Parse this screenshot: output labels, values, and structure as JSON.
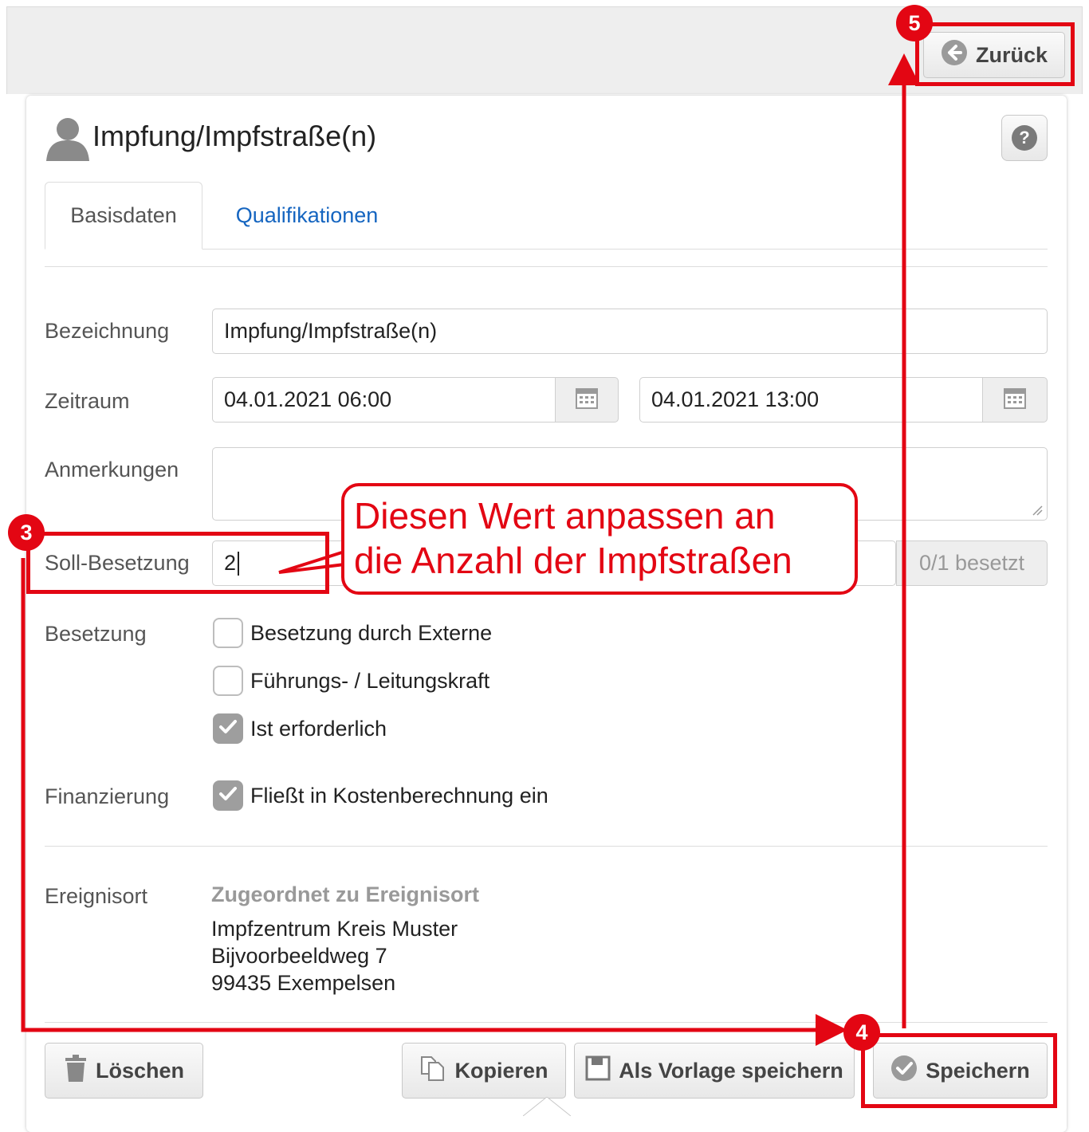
{
  "header": {
    "back_label": "Zurück"
  },
  "page": {
    "title": "Impfung/Impfstraße(n)",
    "help_symbol": "?"
  },
  "tabs": [
    {
      "label": "Basisdaten",
      "active": true
    },
    {
      "label": "Qualifikationen",
      "active": false
    }
  ],
  "form": {
    "bezeichnung_label": "Bezeichnung",
    "bezeichnung_value": "Impfung/Impfstraße(n)",
    "zeitraum_label": "Zeitraum",
    "zeitraum_from": "04.01.2021 06:00",
    "zeitraum_to": "04.01.2021 13:00",
    "anmerkungen_label": "Anmerkungen",
    "anmerkungen_value": "",
    "soll_label": "Soll-Besetzung",
    "soll_value": "2",
    "soll_status": "0/1 besetzt",
    "besetzung_label": "Besetzung",
    "besetzung_options": [
      {
        "label": "Besetzung durch Externe",
        "checked": false
      },
      {
        "label": "Führungs- / Leitungskraft",
        "checked": false
      },
      {
        "label": "Ist erforderlich",
        "checked": true
      }
    ],
    "finanzierung_label": "Finanzierung",
    "finanzierung_option": {
      "label": "Fließt in Kostenberechnung ein",
      "checked": true
    }
  },
  "ereignisort": {
    "label": "Ereignisort",
    "heading": "Zugeordnet zu Ereignisort",
    "line1": "Impfzentrum Kreis Muster",
    "line2": "Bijvoorbeeldweg 7",
    "line3": "99435 Exempelsen"
  },
  "footer": {
    "delete_label": "Löschen",
    "copy_label": "Kopieren",
    "template_label": "Als Vorlage speichern",
    "save_label": "Speichern"
  },
  "annotations": {
    "callout_line1": "Diesen Wert anpassen an",
    "callout_line2": "die Anzahl der Impfstraßen",
    "badge_3": "3",
    "badge_4": "4",
    "badge_5": "5",
    "color": "#e30613"
  },
  "colors": {
    "link": "#1565c0",
    "check_fill": "#9e9e9e"
  }
}
